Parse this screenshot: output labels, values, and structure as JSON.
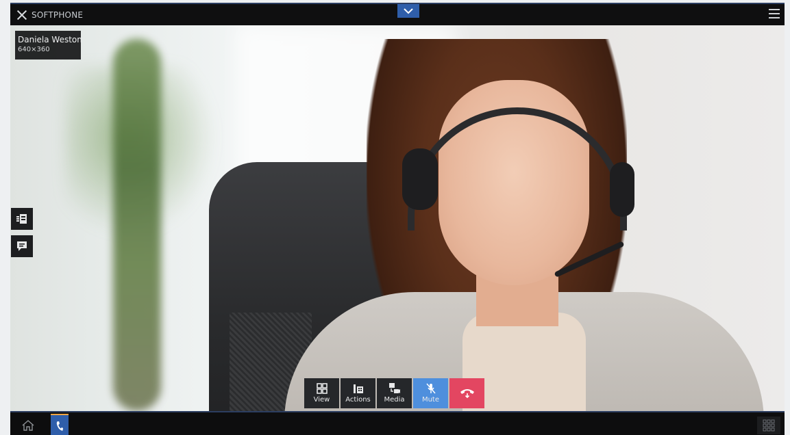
{
  "titlebar": {
    "title": "SOFTPHONE",
    "close_icon": "close-icon",
    "collapse_icon": "chevron-down-icon",
    "menu_icon": "hamburger-menu-icon",
    "accent": "#2f5eaa"
  },
  "caller": {
    "name": "Daniela Weston",
    "resolution": "640×360"
  },
  "side_buttons": [
    {
      "icon": "transfer-contact-icon"
    },
    {
      "icon": "chat-message-icon"
    }
  ],
  "controls": [
    {
      "label": "View",
      "icon": "grid-view-icon"
    },
    {
      "label": "Actions",
      "icon": "dialpad-actions-icon"
    },
    {
      "label": "Media",
      "icon": "media-switch-icon"
    },
    {
      "label": "Mute",
      "icon": "mic-muted-icon",
      "color": "#4e8fdd"
    },
    {
      "label": "",
      "icon": "hangup-icon",
      "color": "#e34661"
    }
  ],
  "taskbar": {
    "home_icon": "home-icon",
    "phone_icon": "phone-icon",
    "apps_icon": "app-grid-icon"
  }
}
